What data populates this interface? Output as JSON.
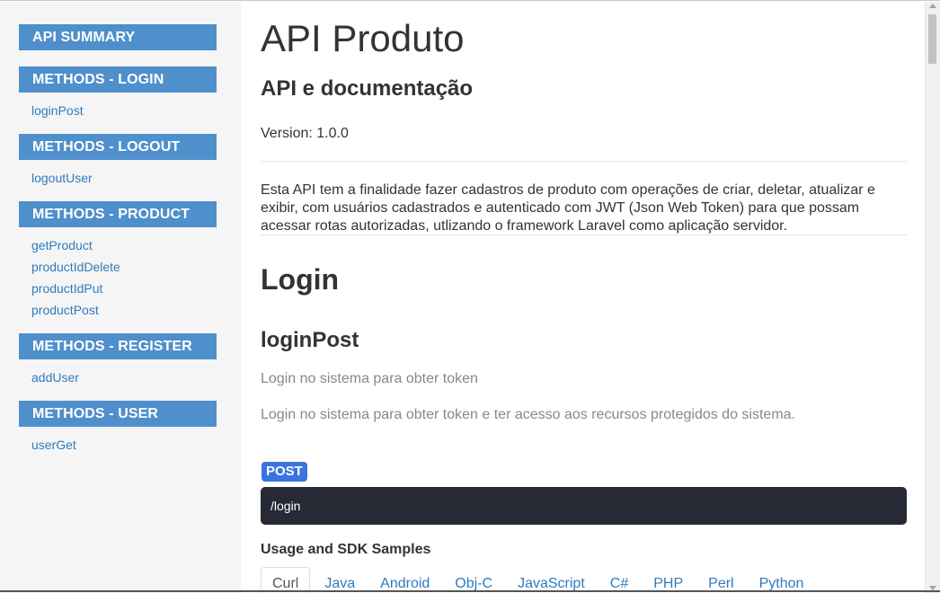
{
  "sidebar": {
    "summary_label": "API SUMMARY",
    "groups": [
      {
        "header": "METHODS - LOGIN",
        "items": [
          "loginPost"
        ]
      },
      {
        "header": "METHODS - LOGOUT",
        "items": [
          "logoutUser"
        ]
      },
      {
        "header": "METHODS - PRODUCT",
        "items": [
          "getProduct",
          "productIdDelete",
          "productIdPut",
          "productPost"
        ]
      },
      {
        "header": "METHODS - REGISTER",
        "items": [
          "addUser"
        ]
      },
      {
        "header": "METHODS - USER",
        "items": [
          "userGet"
        ]
      }
    ]
  },
  "main": {
    "title": "API Produto",
    "subtitle": "API e documentação",
    "version": "Version: 1.0.0",
    "description": "Esta API tem a finalidade fazer cadastros de produto com operações de criar, deletar, atualizar e exibir, com usuários cadastrados e autenticado com JWT (Json Web Token) para que possam acessar rotas autorizadas, utlizando o framework Laravel como aplicação servidor.",
    "section_title": "Login",
    "method": {
      "name": "loginPost",
      "summary": "Login no sistema para obter token",
      "notes": "Login no sistema para obter token e ter acesso aos recursos protegidos do sistema.",
      "verb": "POST",
      "path": "/login"
    },
    "usage_title": "Usage and SDK Samples",
    "tabs": [
      "Curl",
      "Java",
      "Android",
      "Obj-C",
      "JavaScript",
      "C#",
      "PHP",
      "Perl",
      "Python"
    ],
    "active_tab": "Curl"
  },
  "colors": {
    "sidebar_header_bg": "#4f8fcc",
    "link": "#2f7bbf",
    "verb_bg": "#3b73e3",
    "path_bg": "#272a35"
  }
}
